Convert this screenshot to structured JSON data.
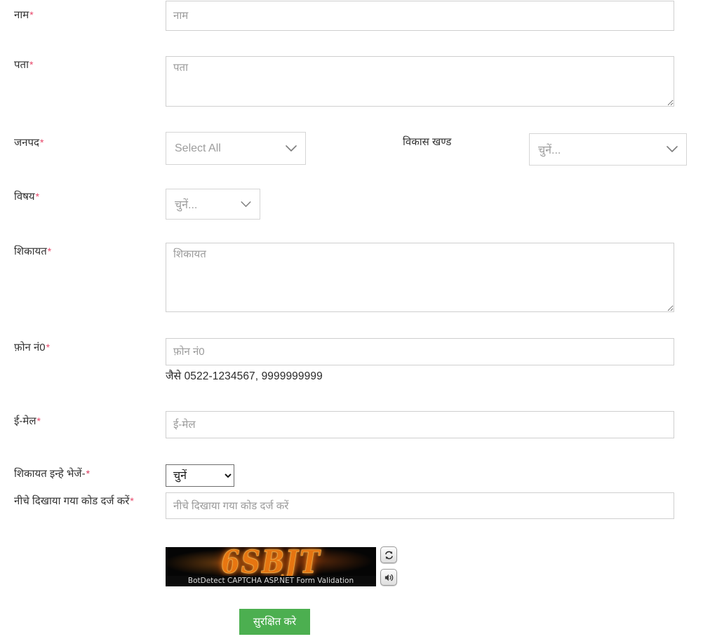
{
  "form": {
    "fields": {
      "name": {
        "label": "नाम",
        "required": true,
        "placeholder": "नाम",
        "value": ""
      },
      "address": {
        "label": "पता",
        "required": true,
        "placeholder": "पता",
        "value": ""
      },
      "district": {
        "label": "जनपद",
        "required": true,
        "selected": "Select All"
      },
      "block": {
        "label": "विकास खण्ड",
        "required": false,
        "selected": "चुनें..."
      },
      "subject": {
        "label": "विषय",
        "required": true,
        "selected": "चुनें..."
      },
      "complaint": {
        "label": "शिकायत",
        "required": true,
        "placeholder": "शिकायत",
        "value": ""
      },
      "phone": {
        "label": "फ़ोन नं0",
        "required": true,
        "placeholder": "फ़ोन नं0",
        "value": "",
        "hint": "जैसे 0522-1234567, 9999999999"
      },
      "email": {
        "label": "ई-मेल",
        "required": true,
        "placeholder": "ई-मेल",
        "value": ""
      },
      "send_to": {
        "label": "शिकायत इन्हे भेजें-",
        "required": true,
        "selected": "चुनें",
        "options": [
          "चुनें"
        ]
      },
      "captcha_code": {
        "label": "नीचे दिखाया गया कोड दर्ज करें",
        "required": true,
        "placeholder": "नीचे दिखाया गया कोड दर्ज करें",
        "value": ""
      }
    },
    "captcha": {
      "code_text": "6SBJT",
      "caption": "BotDetect CAPTCHA ASP.NET Form Validation",
      "reload_icon": "refresh-icon",
      "audio_icon": "speaker-icon"
    },
    "submit": {
      "label": "सुरक्षित करे"
    },
    "required_marker": "*",
    "colors": {
      "submit_green": "#4caf50",
      "required_red": "#e8476a",
      "captcha_orange": "#f07a12",
      "border_grey": "#cfcfcf",
      "placeholder_grey": "#9b9b9b"
    }
  }
}
